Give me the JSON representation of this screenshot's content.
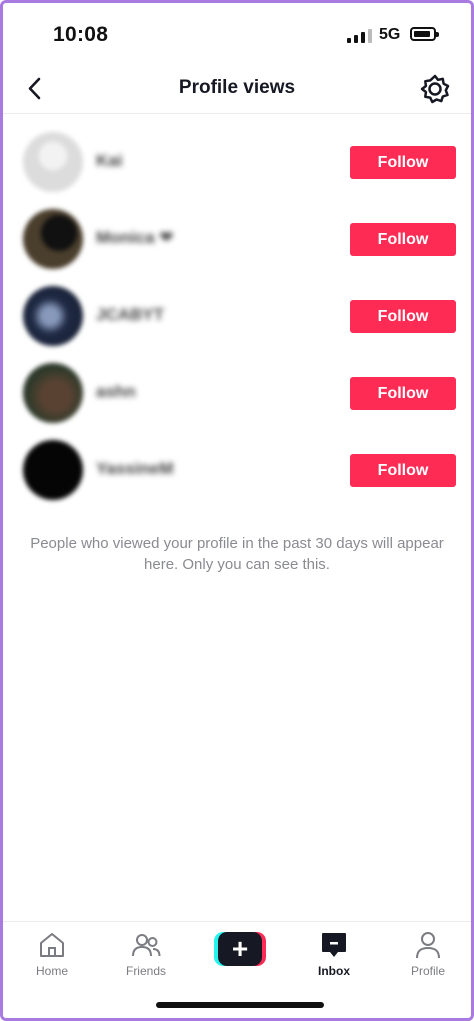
{
  "status_bar": {
    "time": "10:08",
    "network": "5G"
  },
  "header": {
    "title": "Profile views"
  },
  "viewers": [
    {
      "name": "Kai",
      "avatar_color": "#dcdcdc",
      "follow_label": "Follow"
    },
    {
      "name": "Monica ❤",
      "avatar_color": "#3a3226",
      "follow_label": "Follow"
    },
    {
      "name": "JCABYT",
      "avatar_color": "#2c3550",
      "follow_label": "Follow"
    },
    {
      "name": "ashn",
      "avatar_color": "#2f3a2a",
      "follow_label": "Follow"
    },
    {
      "name": "YassineM",
      "avatar_color": "#050505",
      "follow_label": "Follow"
    }
  ],
  "info_note": "People who viewed your profile in the past 30 days will appear here. Only you can see this.",
  "tab_bar": {
    "home": "Home",
    "friends": "Friends",
    "create_symbol": "+",
    "inbox": "Inbox",
    "profile": "Profile",
    "active_tab": "inbox"
  },
  "colors": {
    "accent": "#fe2c55",
    "cyan": "#25f4ee",
    "text": "#161823",
    "muted": "#8a8b91"
  }
}
